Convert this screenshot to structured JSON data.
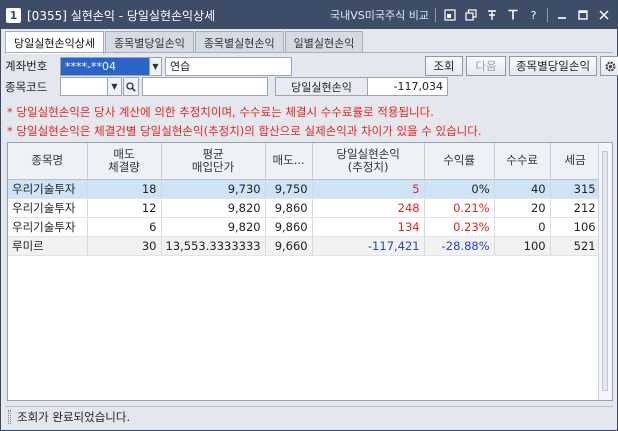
{
  "window": {
    "badge": "1",
    "title": "[0355] 실현손익 - 당일실현손익상세",
    "link": "국내VS미국주식 비교",
    "help": "?"
  },
  "tabs": [
    {
      "label": "당일실현손익상세",
      "active": true
    },
    {
      "label": "종목별당일손익",
      "active": false
    },
    {
      "label": "종목별실현손익",
      "active": false
    },
    {
      "label": "일별실현손익",
      "active": false
    }
  ],
  "form": {
    "account_label": "계좌번호",
    "account_value": "****-**04",
    "account_name": "연습",
    "query_button": "조회",
    "next_button": "다음",
    "daily_button": "종목별당일손익",
    "stock_code_label": "종목코드",
    "stock_code_value": "",
    "stock_name_value": "",
    "realized_label": "당일실현손익",
    "realized_value": "-117,034"
  },
  "notices": [
    "* 당일실현손익은 당사 계산에 의한 추정치이며, 수수료는 체결시 수수료률로 적용됩니다.",
    "* 당일실현손익은 체결건별 당일실현손익(추정치)의 합산으로 실제손익과 차이가 있을 수 있습니다."
  ],
  "table": {
    "headers": [
      {
        "line1": "종목명",
        "line2": ""
      },
      {
        "line1": "매도",
        "line2": "체결량"
      },
      {
        "line1": "평균",
        "line2": "매입단가"
      },
      {
        "line1": "매도...",
        "line2": ""
      },
      {
        "line1": "당일실현손익",
        "line2": "(추정치)"
      },
      {
        "line1": "수익률",
        "line2": ""
      },
      {
        "line1": "수수료",
        "line2": ""
      },
      {
        "line1": "세금",
        "line2": ""
      }
    ],
    "rows": [
      {
        "name": "우리기술투자",
        "qty": "18",
        "avg": "9,730",
        "sell": "9,750",
        "pnl": "5",
        "rate": "0%",
        "fee": "40",
        "tax": "315",
        "pnl_color": "red",
        "rate_color": "default"
      },
      {
        "name": "우리기술투자",
        "qty": "12",
        "avg": "9,820",
        "sell": "9,860",
        "pnl": "248",
        "rate": "0.21%",
        "fee": "20",
        "tax": "212",
        "pnl_color": "red",
        "rate_color": "red"
      },
      {
        "name": "우리기술투자",
        "qty": "6",
        "avg": "9,820",
        "sell": "9,860",
        "pnl": "134",
        "rate": "0.23%",
        "fee": "0",
        "tax": "106",
        "pnl_color": "red",
        "rate_color": "red"
      },
      {
        "name": "루미르",
        "qty": "30",
        "avg": "13,553.3333333",
        "sell": "9,660",
        "pnl": "-117,421",
        "rate": "-28.88%",
        "fee": "100",
        "tax": "521",
        "pnl_color": "blue",
        "rate_color": "blue"
      }
    ]
  },
  "status": {
    "message": "조회가 완료되었습니다."
  },
  "colors": {
    "titlebar": "#3d4d68",
    "positive": "#e0261e",
    "negative": "#2643c8",
    "selected_row": "#cfe3f7"
  }
}
